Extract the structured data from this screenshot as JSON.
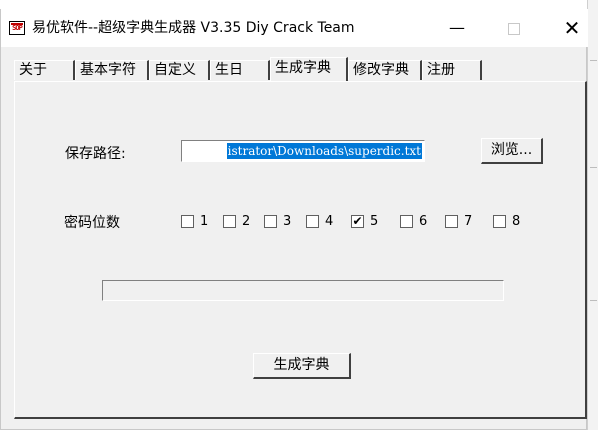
{
  "window": {
    "title": "易优软件--超级字典生成器 V3.35  Diy Crack Team",
    "icon_text": "SOP",
    "minimize_glyph": "—",
    "close_glyph": "✕"
  },
  "tabs": [
    {
      "label": "关于",
      "active": false
    },
    {
      "label": "基本字符",
      "active": false
    },
    {
      "label": "自定义",
      "active": false
    },
    {
      "label": "生日",
      "active": false
    },
    {
      "label": "生成字典",
      "active": true
    },
    {
      "label": "修改字典",
      "active": false
    },
    {
      "label": "注册",
      "active": false
    }
  ],
  "panel": {
    "save_path_label": "保存路径:",
    "save_path_value": "istrator\\Downloads\\superdic.txt",
    "browse_label": "浏览...",
    "digits_label": "密码位数",
    "digit_options": [
      {
        "label": "1",
        "checked": false
      },
      {
        "label": "2",
        "checked": false
      },
      {
        "label": "3",
        "checked": false
      },
      {
        "label": "4",
        "checked": false
      },
      {
        "label": "5",
        "checked": true
      },
      {
        "label": "6",
        "checked": false
      },
      {
        "label": "7",
        "checked": false
      },
      {
        "label": "8",
        "checked": false
      }
    ],
    "progress_fraction": 0,
    "generate_label": "生成字典"
  },
  "colors": {
    "selection": "#0078d7",
    "window_bg": "#f0f0f0",
    "titlebar_bg": "#ffffff"
  }
}
